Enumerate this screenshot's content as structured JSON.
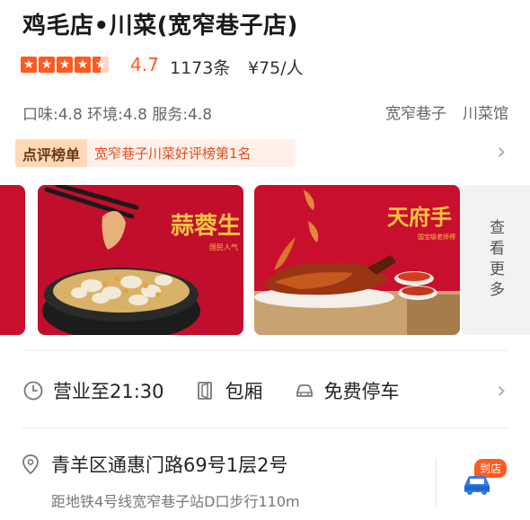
{
  "shop": {
    "name": "鸡毛店•川菜(宽窄巷子店)",
    "rating": "4.7",
    "reviews": "1173条",
    "price": "¥75/人",
    "stars": 4.5,
    "subscores": "口味:4.8 环境:4.8 服务:4.8",
    "tags": [
      "宽窄巷子",
      "川菜馆"
    ]
  },
  "ranking": {
    "badge": "点评榜单",
    "text": "宽窄巷子川菜好评榜第1名"
  },
  "photos": [
    {
      "overlay": "蒜蓉生",
      "caption": "国民人气"
    },
    {
      "overlay": "天府手",
      "caption": "国宝级老师傅"
    }
  ],
  "more_label": "查看更多",
  "hours": {
    "label": "营业至21:30"
  },
  "features": [
    {
      "label": "包厢"
    },
    {
      "label": "免费停车"
    }
  ],
  "address": {
    "text": "青羊区通惠门路69号1层2号",
    "subway": "距地铁4号线宽窄巷子站D口步行110m",
    "nav_badge": "到店"
  },
  "colors": {
    "accent": "#ff5a1f",
    "banner_red": "#c8102e"
  },
  "icons": [
    "star-icon",
    "chevron-right-icon",
    "clock-icon",
    "private-room-icon",
    "car-icon",
    "location-pin-icon"
  ]
}
